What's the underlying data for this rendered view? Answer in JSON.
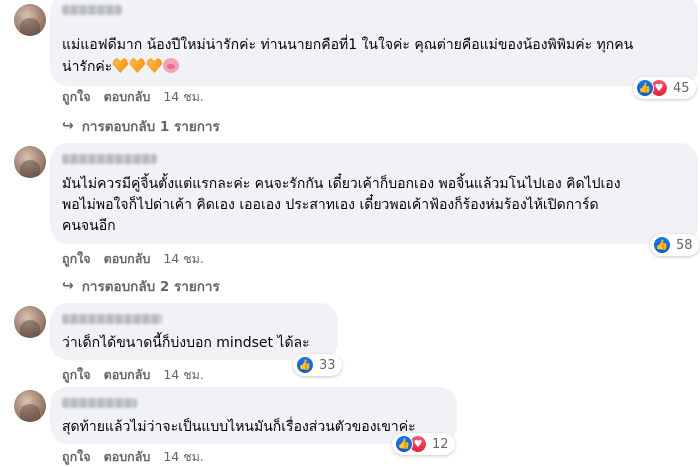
{
  "comments": [
    {
      "text": "แม่แอฟดีมาก น้องปีใหม่น่ารักค่ะ ท่านนายกคือที่1 ในใจค่ะ คุณต่ายคือแม่ของน้องพิพิมค่ะ ทุกคน\nน่ารักค่ะ",
      "emojis": [
        "orange-heart",
        "orange-heart",
        "orange-heart",
        "pig-face"
      ],
      "reactions": {
        "count": "45",
        "types": [
          "like",
          "love"
        ]
      },
      "like_label": "ถูกใจ",
      "reply_label": "ตอบกลับ",
      "time": "14 ชม.",
      "replies_label": "การตอบกลับ 1 รายการ"
    },
    {
      "text": "มันไม่ควรมีคู่จิ้นตั้งแต่แรกละค่ะ คนจะรักกัน เดี๋ยวเค้าก็บอกเอง พอจิ้นแล้วมโนไปเอง คิดไปเอง\nพอไม่พอใจก็ไปด่าเค้า คิดเอง เออเอง ประสาทเอง เดี๋ยวพอเค้าฟ้องก็ร้องห่มร้องไห้เปิดการ์ด\nคนจนอีก",
      "reactions": {
        "count": "58",
        "types": [
          "like"
        ]
      },
      "like_label": "ถูกใจ",
      "reply_label": "ตอบกลับ",
      "time": "14 ชม.",
      "replies_label": "การตอบกลับ 2 รายการ"
    },
    {
      "text": "ว่าเด็กได้ขนาดนี้ก็บ่งบอก mindset ได้ละ",
      "reactions": {
        "count": "33",
        "types": [
          "like"
        ]
      },
      "like_label": "ถูกใจ",
      "reply_label": "ตอบกลับ",
      "time": "14 ชม."
    },
    {
      "text": "สุดท้ายแล้วไม่ว่าจะเป็นแบบไหนมันก็เรื่องส่วนตัวของเขาค่ะ",
      "reactions": {
        "count": "12",
        "types": [
          "like",
          "love"
        ]
      },
      "like_label": "ถูกใจ",
      "reply_label": "ตอบกลับ",
      "time": "14 ชม."
    }
  ]
}
